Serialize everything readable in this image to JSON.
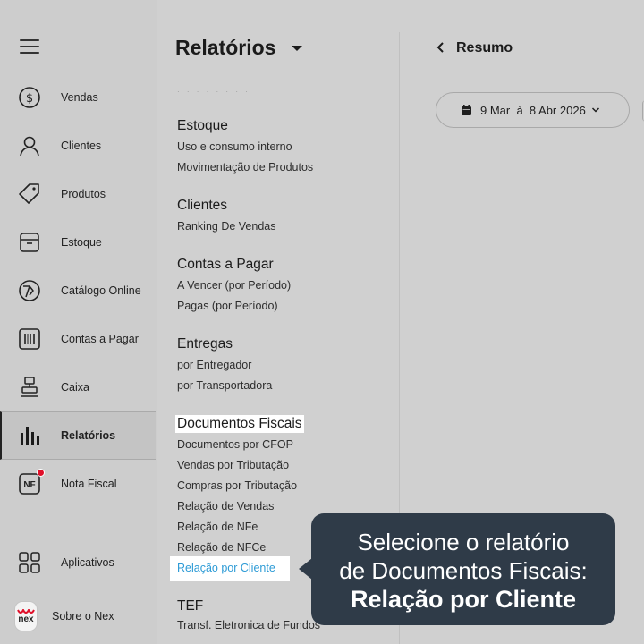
{
  "sidebar": {
    "items": [
      {
        "label": "Vendas",
        "icon": "dollar-circle-icon"
      },
      {
        "label": "Clientes",
        "icon": "user-icon"
      },
      {
        "label": "Produtos",
        "icon": "tag-icon"
      },
      {
        "label": "Estoque",
        "icon": "box-icon"
      },
      {
        "label": "Catálogo Online",
        "icon": "catalog-icon"
      },
      {
        "label": "Contas a Pagar",
        "icon": "barcode-icon"
      },
      {
        "label": "Caixa",
        "icon": "cash-register-icon"
      },
      {
        "label": "Relatórios",
        "icon": "bar-chart-icon",
        "active": true
      },
      {
        "label": "Nota Fiscal",
        "icon": "nf-icon",
        "badge": true
      }
    ],
    "apps_label": "Aplicativos",
    "about_label": "Sobre o Nex",
    "logo_text": "nex"
  },
  "panel": {
    "title": "Relatórios",
    "sections": [
      {
        "title": "Estoque",
        "links": [
          "Uso e consumo interno",
          "Movimentação de Produtos"
        ]
      },
      {
        "title": "Clientes",
        "links": [
          "Ranking De Vendas"
        ]
      },
      {
        "title": "Contas a Pagar",
        "links": [
          "A Vencer (por Período)",
          "Pagas (por Período)"
        ]
      },
      {
        "title": "Entregas",
        "links": [
          "por Entregador",
          "por Transportadora"
        ]
      },
      {
        "title": "Documentos Fiscais",
        "links": [
          "Documentos por CFOP",
          "Vendas por Tributação",
          "Compras por Tributação",
          "Relação de Vendas",
          "Relação de NFe",
          "Relação de NFCe",
          "Relação por Cliente"
        ]
      },
      {
        "title": "TEF",
        "links": [
          "Transf. Eletronica de Fundos"
        ]
      }
    ]
  },
  "main": {
    "back_label": "Resumo",
    "date_range": "9 Mar  à  8 Abr 2026"
  },
  "callout": {
    "line1": "Selecione o relatório",
    "line2": "de Documentos Fiscais:",
    "line3": "Relação por Cliente"
  },
  "colors": {
    "highlight_link": "#2d9bd6",
    "callout_bg": "#2f3b48",
    "badge": "#e0102a"
  }
}
